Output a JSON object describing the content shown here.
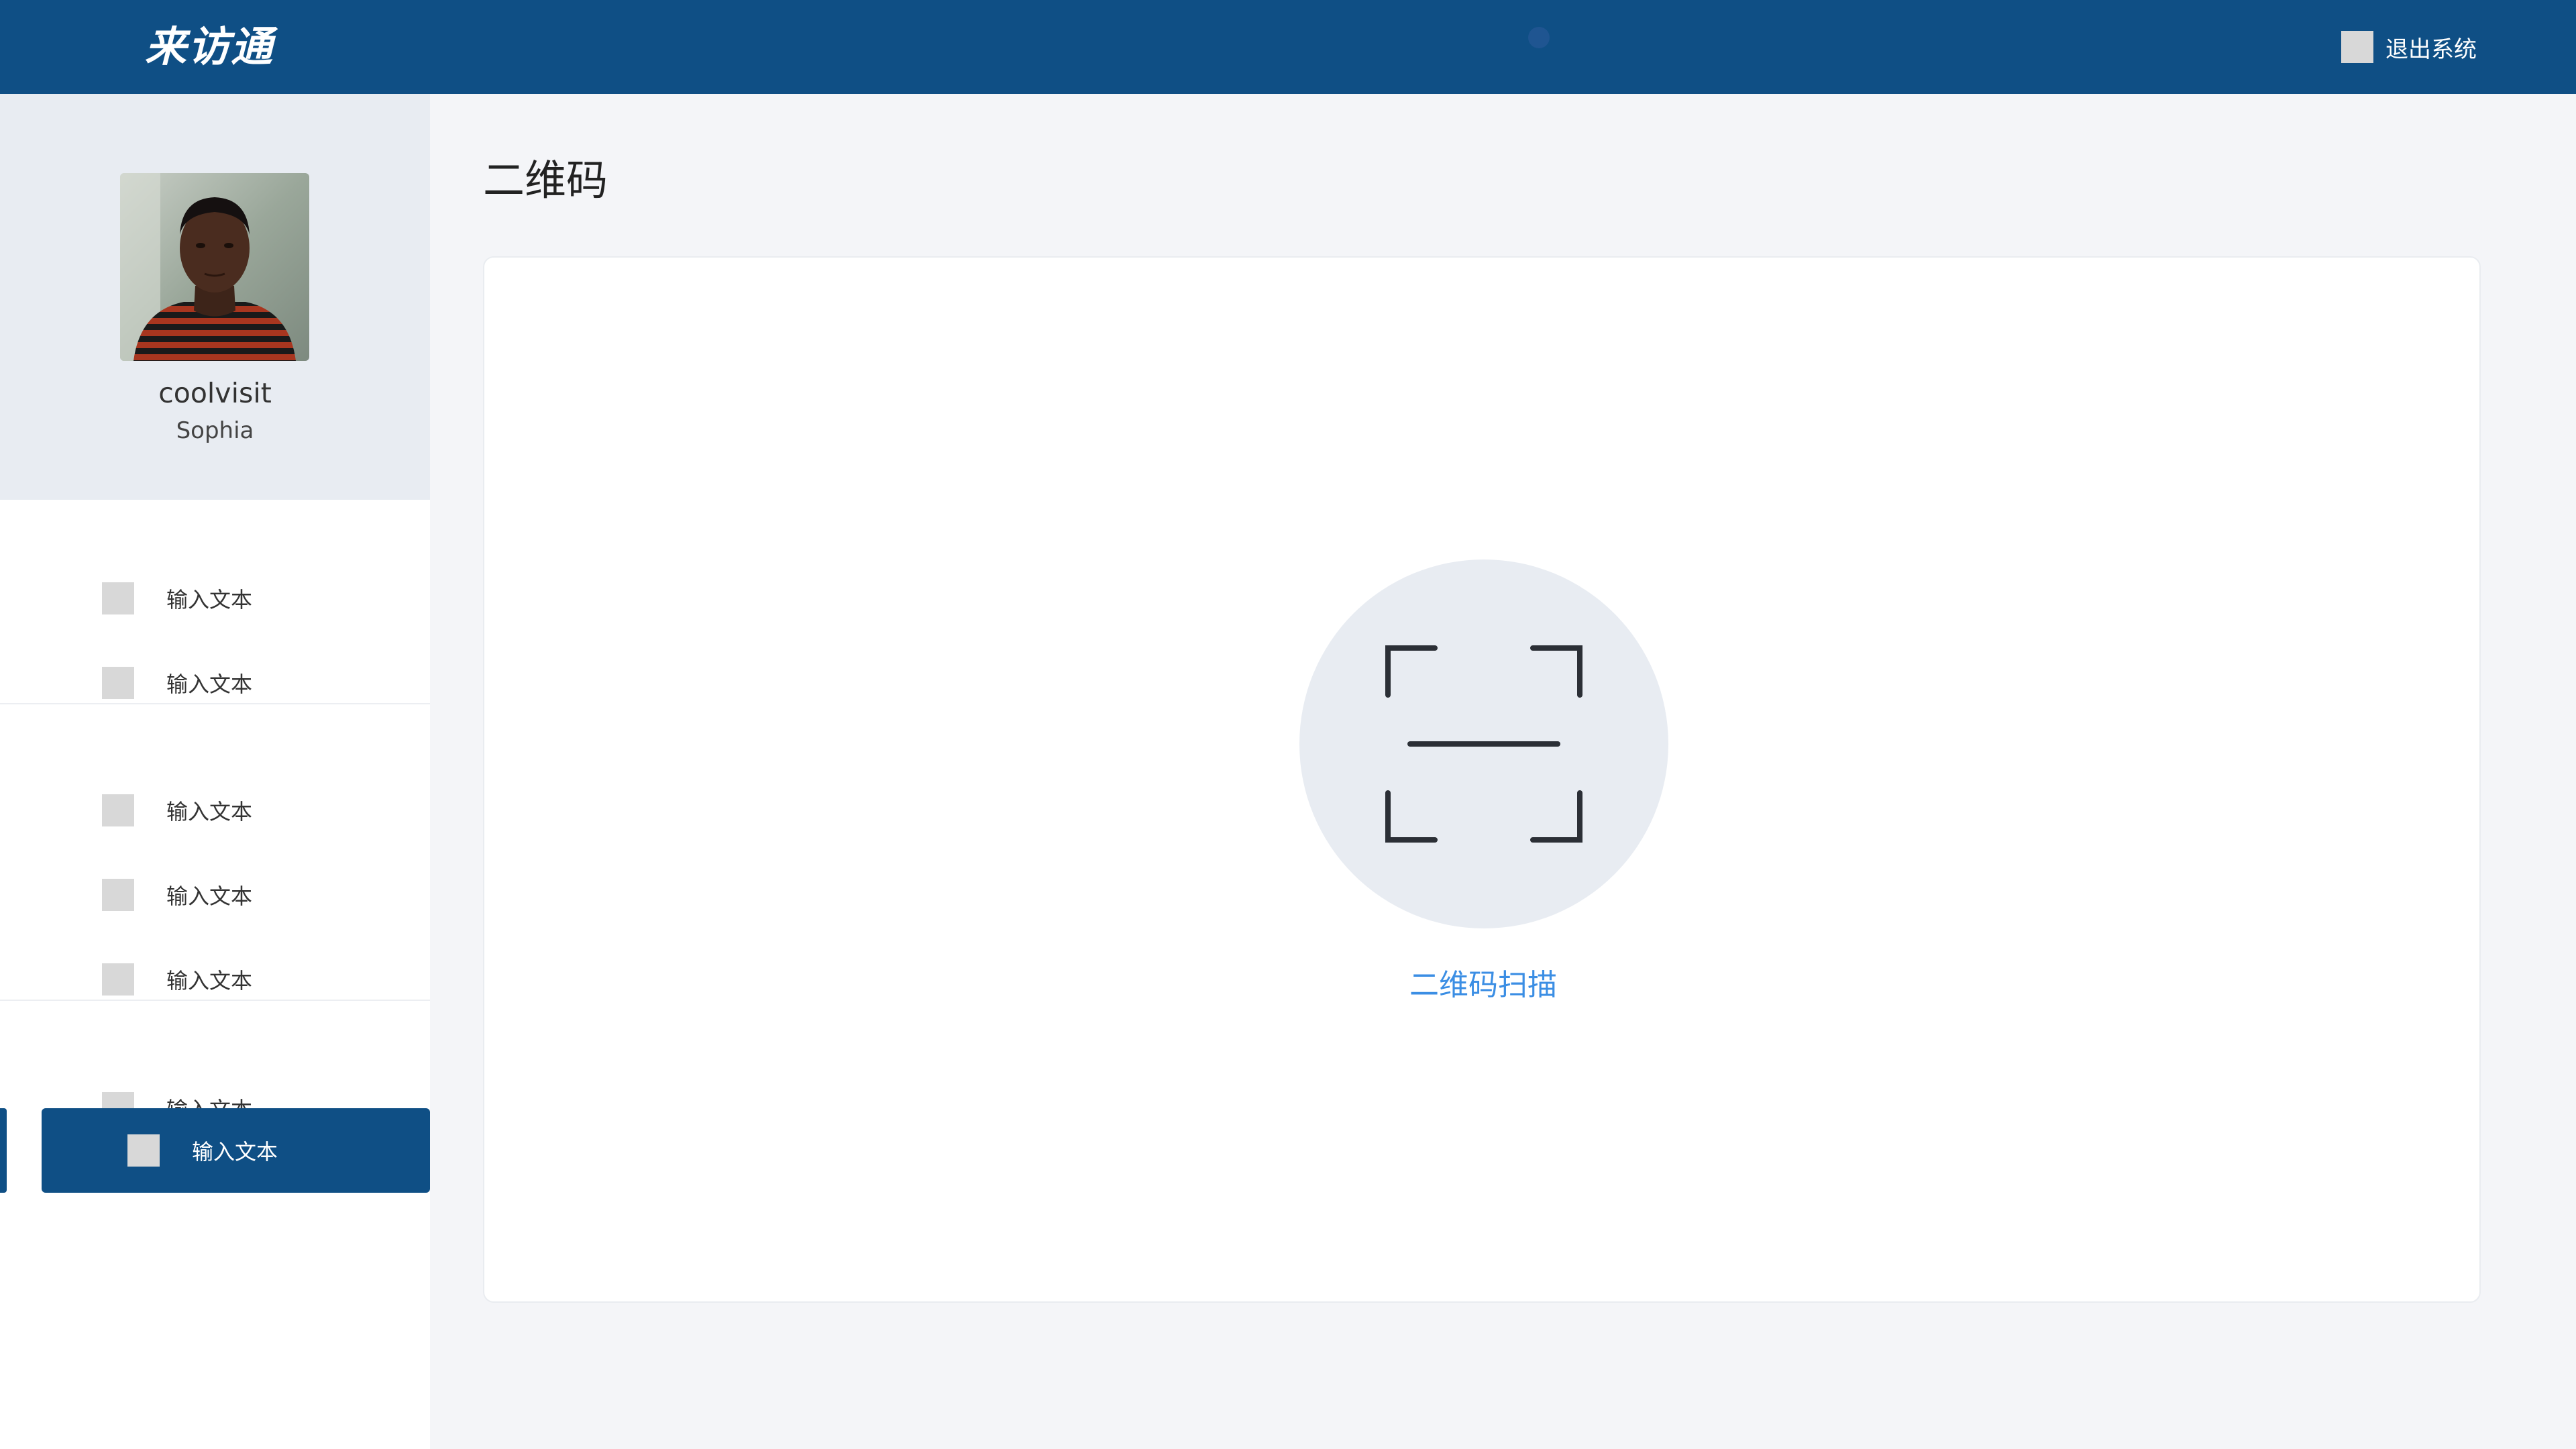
{
  "header": {
    "logo_text": "来访通",
    "logout_label": "退出系统",
    "logout_icon": "placeholder-square-icon"
  },
  "profile": {
    "username": "coolvisit",
    "realname": "Sophia"
  },
  "sidebar": {
    "items": [
      {
        "label": "输入文本",
        "icon": "placeholder-square-icon"
      },
      {
        "label": "输入文本",
        "icon": "placeholder-square-icon"
      },
      {
        "label": "输入文本",
        "icon": "placeholder-square-icon"
      },
      {
        "label": "输入文本",
        "icon": "placeholder-square-icon"
      },
      {
        "label": "输入文本",
        "icon": "placeholder-square-icon"
      },
      {
        "label": "输入文本",
        "icon": "placeholder-square-icon"
      },
      {
        "label": "输入文本",
        "icon": "placeholder-square-icon",
        "active": true
      }
    ]
  },
  "main": {
    "title": "二维码",
    "scan_label": "二维码扫描",
    "scan_icon": "qr-scan-icon"
  },
  "colors": {
    "brand": "#0f4f85",
    "link": "#3b8ee4",
    "profile_bg": "#e8ecf2"
  }
}
